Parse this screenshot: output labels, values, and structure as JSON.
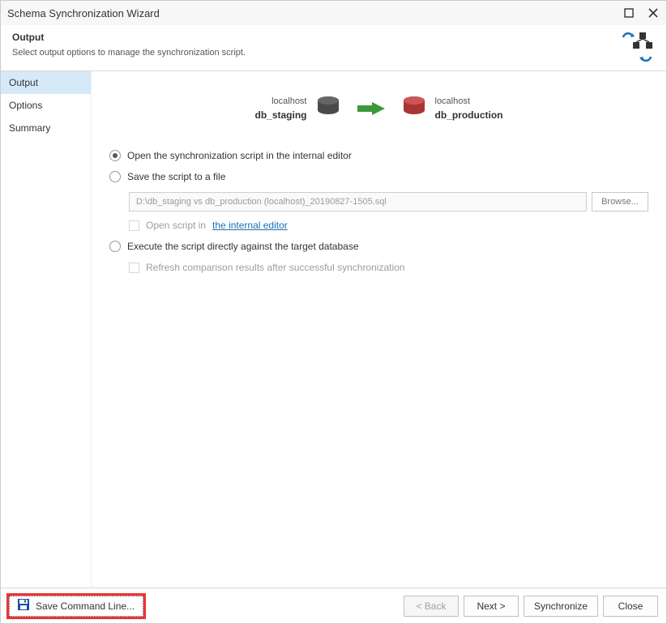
{
  "window": {
    "title": "Schema Synchronization Wizard"
  },
  "subheader": {
    "title": "Output",
    "description": "Select output options to manage the synchronization script."
  },
  "sidebar": {
    "items": [
      {
        "label": "Output",
        "active": true
      },
      {
        "label": "Options",
        "active": false
      },
      {
        "label": "Summary",
        "active": false
      }
    ]
  },
  "databases": {
    "source": {
      "host": "localhost",
      "name": "db_staging"
    },
    "target": {
      "host": "localhost",
      "name": "db_production"
    }
  },
  "options": {
    "open_internal": {
      "label": "Open the synchronization script in the internal editor",
      "checked": true
    },
    "save_file": {
      "label": "Save the script to a file",
      "checked": false
    },
    "file_path": "D:\\db_staging vs db_production (localhost)_20190827-1505.sql",
    "browse_label": "Browse...",
    "open_in_prefix": "Open script in ",
    "open_in_link": "the internal editor",
    "execute": {
      "label": "Execute the script directly against the target database",
      "checked": false
    },
    "refresh_label": "Refresh comparison results after successful synchronization"
  },
  "footer": {
    "save_cmd": "Save Command Line...",
    "back": "< Back",
    "next": "Next >",
    "synchronize": "Synchronize",
    "close": "Close"
  }
}
